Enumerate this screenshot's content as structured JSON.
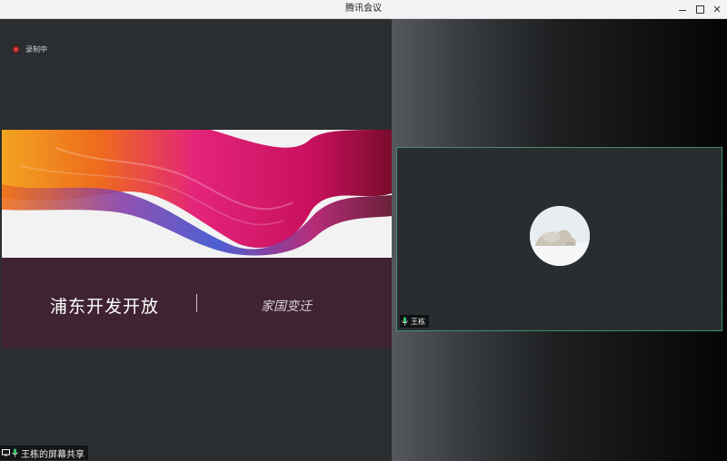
{
  "window": {
    "title": "腾讯会议",
    "controls": [
      "minimize-icon",
      "maximize-icon",
      "close-icon"
    ]
  },
  "share": {
    "recording_label": "录制中",
    "slide": {
      "main_text": "浦东开发开放",
      "sub_text": "家国变迁",
      "colors": {
        "top_background": "#f2f2f2",
        "bottom_background": "#3f2331",
        "wave_orange": "#f08a1c",
        "wave_magenta": "#d0186f",
        "wave_blue": "#3a3fc8"
      }
    },
    "share_label": "王栋的屏幕共享",
    "share_label_icons": [
      "screen-share-icon",
      "mic-icon"
    ]
  },
  "gallery": {
    "participant": {
      "name": "王栋",
      "mic_icon": "mic-icon",
      "active_border_color": "#3f8f6e"
    }
  }
}
